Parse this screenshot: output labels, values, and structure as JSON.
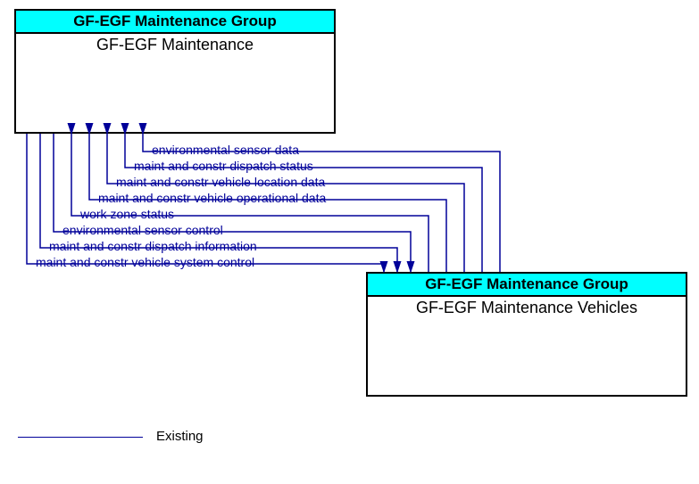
{
  "box1": {
    "header": "GF-EGF Maintenance Group",
    "sub": "GF-EGF Maintenance"
  },
  "box2": {
    "header": "GF-EGF Maintenance Group",
    "sub": "GF-EGF Maintenance Vehicles"
  },
  "flows": {
    "f1": "environmental sensor data",
    "f2": "maint and constr dispatch status",
    "f3": "maint and constr vehicle location data",
    "f4": "maint and constr vehicle operational data",
    "f5": "work zone status",
    "f6": "environmental sensor control",
    "f7": "maint and constr dispatch information",
    "f8": "maint and constr vehicle system control"
  },
  "legend": {
    "existing": "Existing"
  },
  "colors": {
    "line": "#000099",
    "header_bg": "#00ffff"
  }
}
